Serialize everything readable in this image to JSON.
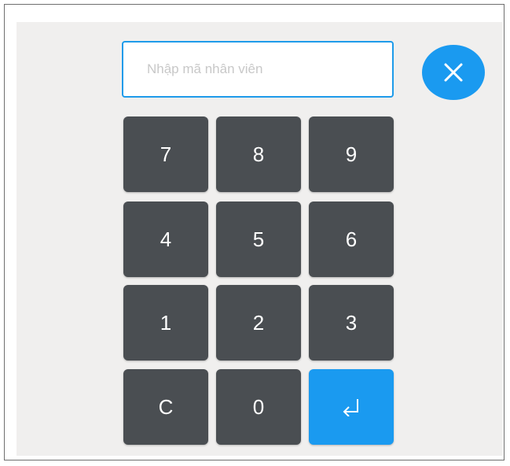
{
  "input": {
    "placeholder": "Nhập mã nhân viên",
    "value": ""
  },
  "close": {
    "icon": "close-icon"
  },
  "keys": {
    "k7": "7",
    "k8": "8",
    "k9": "9",
    "k4": "4",
    "k5": "5",
    "k6": "6",
    "k1": "1",
    "k2": "2",
    "k3": "3",
    "clear": "C",
    "k0": "0",
    "enter_icon": "enter-return-icon"
  },
  "colors": {
    "accent": "#1a9af0",
    "key_background": "#4a4e52",
    "panel_background": "#f0efee"
  }
}
